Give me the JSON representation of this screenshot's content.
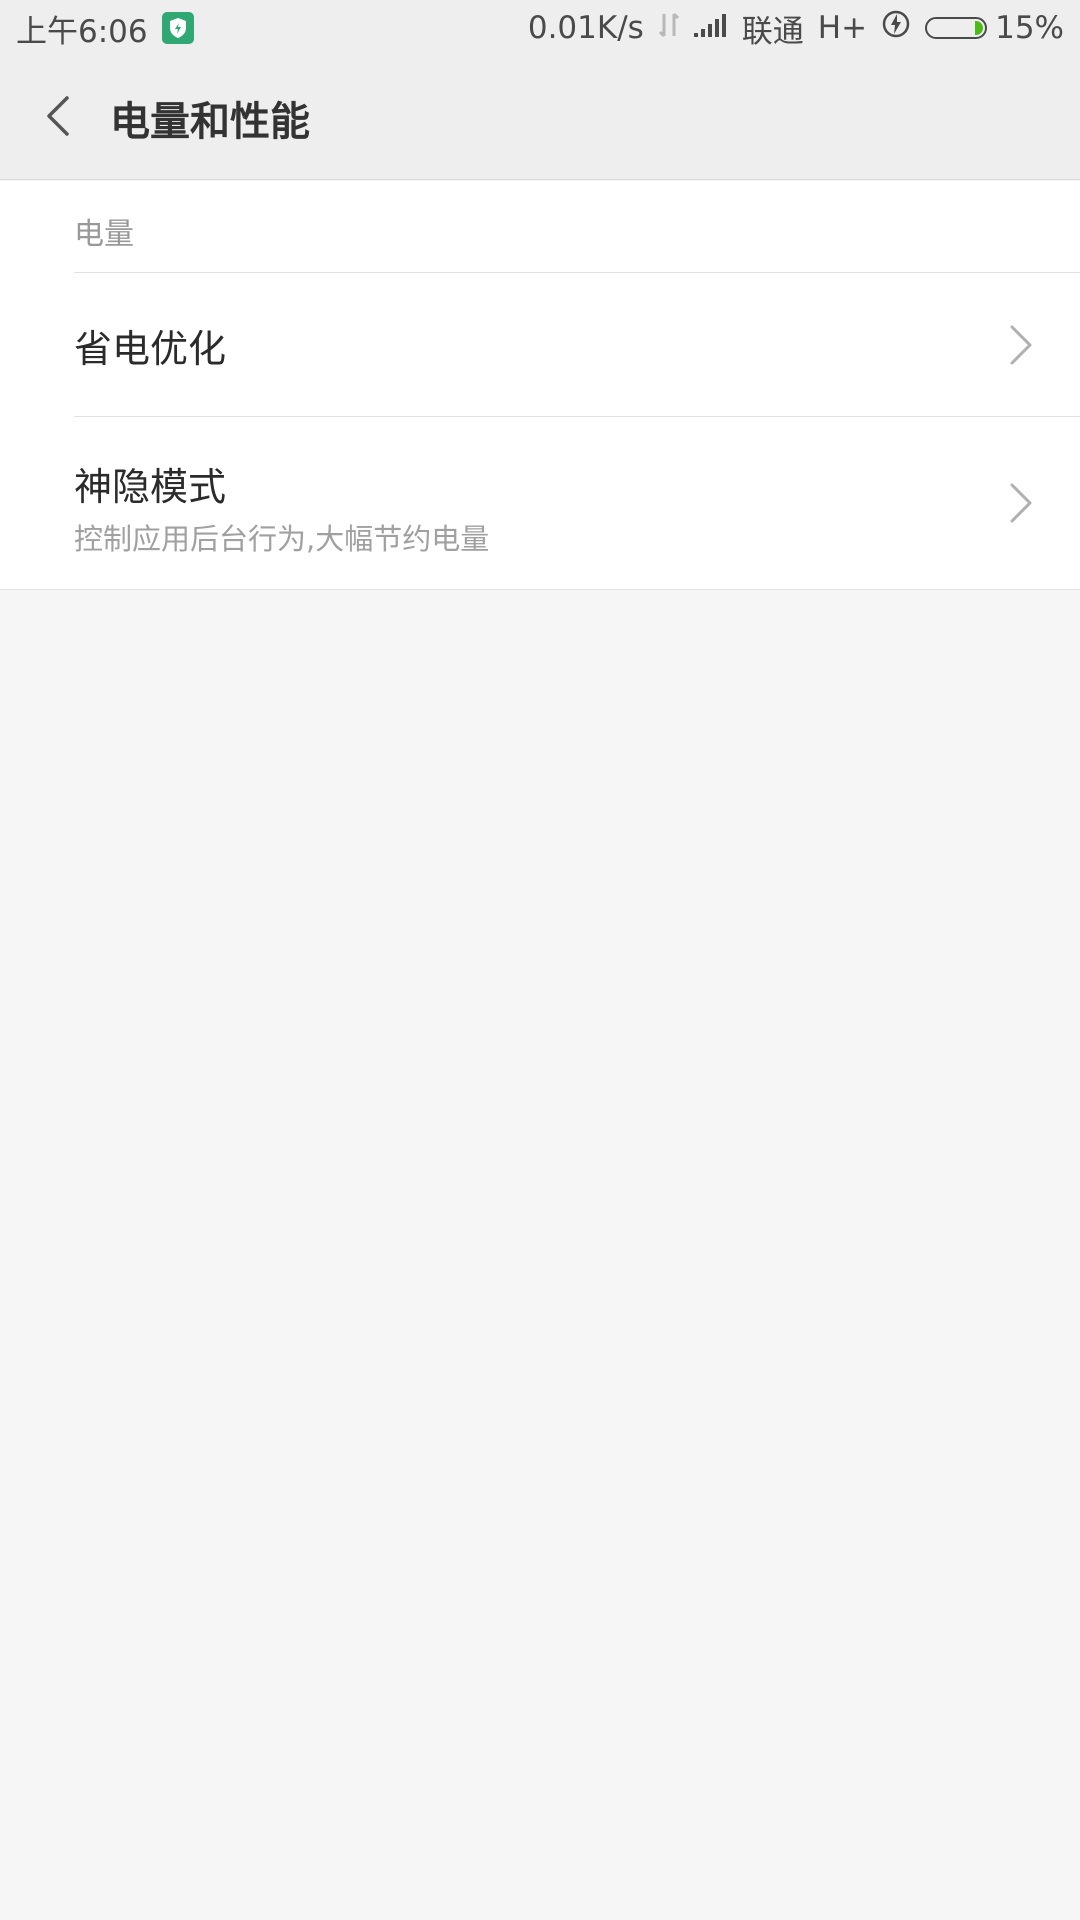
{
  "status_bar": {
    "time": "上午6:06",
    "app_icon": "security-shield-icon",
    "network_speed": "0.01K/s",
    "carrier": "联通",
    "network_type": "H+",
    "battery_percent": "15%",
    "battery_level": 0.15,
    "accent_color": "#2fa873",
    "battery_color": "#4cbb17"
  },
  "header": {
    "title": "电量和性能",
    "back_icon": "back-chevron-icon"
  },
  "section": {
    "label": "电量"
  },
  "items": [
    {
      "title": "省电优化",
      "icon": "chevron-right-icon"
    },
    {
      "title": "神隐模式",
      "subtitle": "控制应用后台行为,大幅节约电量",
      "icon": "chevron-right-icon"
    }
  ]
}
